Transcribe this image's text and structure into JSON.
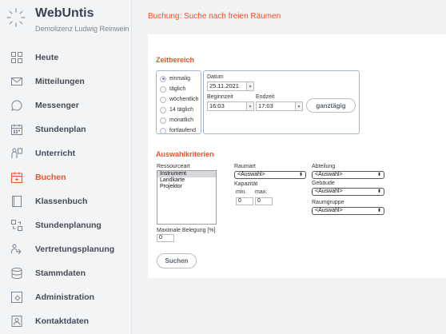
{
  "brand": {
    "title": "WebUntis",
    "subtitle": "Demolizenz Ludwig Reinwein"
  },
  "nav": {
    "items": [
      {
        "label": "Heute",
        "icon": "dashboard-icon"
      },
      {
        "label": "Mitteilungen",
        "icon": "envelope-icon"
      },
      {
        "label": "Messenger",
        "icon": "chat-bubble-icon"
      },
      {
        "label": "Stundenplan",
        "icon": "calendar-icon"
      },
      {
        "label": "Unterricht",
        "icon": "teacher-icon"
      },
      {
        "label": "Buchen",
        "icon": "calendar-plus-icon",
        "active": true
      },
      {
        "label": "Klassenbuch",
        "icon": "book-icon"
      },
      {
        "label": "Stundenplanung",
        "icon": "planning-icon"
      },
      {
        "label": "Vertretungsplanung",
        "icon": "substitution-icon"
      },
      {
        "label": "Stammdaten",
        "icon": "database-icon"
      },
      {
        "label": "Administration",
        "icon": "admin-gear-icon"
      },
      {
        "label": "Kontaktdaten",
        "icon": "contact-card-icon"
      }
    ]
  },
  "page": {
    "title": "Buchung: Suche nach freien Räumen"
  },
  "zeitbereich": {
    "title": "Zeitbereich",
    "options": [
      "einmalig",
      "täglich",
      "wöchentlich",
      "14 täglich",
      "monatlich",
      "fortlaufend"
    ],
    "selected": "einmalig",
    "datum_label": "Datum",
    "datum_value": "25.11.2021",
    "beginnzeit_label": "Beginnzeit",
    "beginnzeit_value": "16:03",
    "endzeit_label": "Endzeit",
    "endzeit_value": "17:03",
    "ganztaegig_label": "ganztägig"
  },
  "auswahl": {
    "title": "Auswahlkriterien",
    "ressourceart_label": "Ressourceart",
    "ressourceart_items": [
      "Instrument",
      "Landkarte",
      "Projektor"
    ],
    "ressourceart_selected": "Instrument",
    "raumart_label": "Raumart",
    "raumart_value": "<Auswahl>",
    "kapazitaet_label": "Kapazität",
    "min_label": "min.",
    "max_label": "max.",
    "min_value": "0",
    "max_value": "0",
    "abteilung_label": "Abteilung",
    "abteilung_value": "<Auswahl>",
    "gebaeude_label": "Gebäude",
    "gebaeude_value": "<Auswahl>",
    "raumgruppe_label": "Raumgruppe",
    "raumgruppe_value": "<Auswahl>",
    "max_belegung_label": "Maximale Belegung [%]",
    "max_belegung_value": "0"
  },
  "actions": {
    "suchen_label": "Suchen"
  }
}
